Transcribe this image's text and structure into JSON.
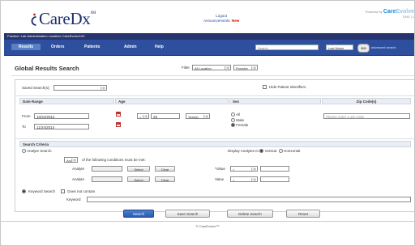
{
  "header": {
    "logo_text": "CareDx",
    "logo_tm": "SM",
    "logout_label": "Logout",
    "announcements_label": "Announcements:",
    "announcements_new": "New",
    "brand_powered": "Powered by",
    "brand_care": "Care",
    "brand_evolve": "Evolve",
    "brand_suffix": "DND | L"
  },
  "infobar": {
    "text": "Practice: Lab Administration   Location: CareEvolve123"
  },
  "nav": {
    "items": [
      "Results",
      "Orders",
      "Patients",
      "Admin",
      "Help"
    ],
    "search_placeholder": "Search",
    "search_field_select": "Last Name",
    "go_label": "GO",
    "advanced_label": "advanced search"
  },
  "page": {
    "title": "Global Results Search",
    "filter_label": "Filter",
    "filter_location": "All Location",
    "filter_provider": "Provider"
  },
  "form": {
    "saved_searches_label": "Saved Search(s):",
    "saved_searches_value": "",
    "hide_ids_label": "Hide Patient Identifiers",
    "date_range": {
      "header": "Date Range",
      "from_label": "From",
      "from_value": "10/24/2014",
      "to_label": "To",
      "to_value": "11/24/2014"
    },
    "age": {
      "header": "Age",
      "operator": "<",
      "value": "25",
      "unit": "Year(s)"
    },
    "sex": {
      "header": "Sex",
      "options": [
        "All",
        "Male",
        "Female"
      ],
      "selected": "Female"
    },
    "zip": {
      "header": "Zip Code(s)",
      "placeholder": "Please enter a zip code"
    },
    "criteria": {
      "header": "Search Criteria",
      "analyte_search_label": "Analyte Search",
      "display_label": "Display Analytes In",
      "vertical_label": "Vertical",
      "horizontal_label": "Horizontal",
      "match_value": "Any",
      "match_text": "of the following conditions must be met:",
      "analyte_label": "Analyte",
      "select_label": "Select",
      "clear_label": "Clear",
      "value_label": "*Value",
      "value_label_2": "Value",
      "value_op": "=",
      "keyword_search_label": "Keyword Search",
      "does_not_contain_label": "Does not contain",
      "keyword_label": "Keyword"
    },
    "buttons": {
      "search": "Search",
      "save_search": "Save Search",
      "delete_search": "Delete Search",
      "reset": "Reset"
    }
  },
  "footer": {
    "text": "© CareEvolve™"
  },
  "colors": {
    "nav_bg": "#2d4f9d",
    "infobar_bg": "#27346e",
    "logo": "#1a2e6e",
    "primary_button": "#2a5bb0"
  }
}
